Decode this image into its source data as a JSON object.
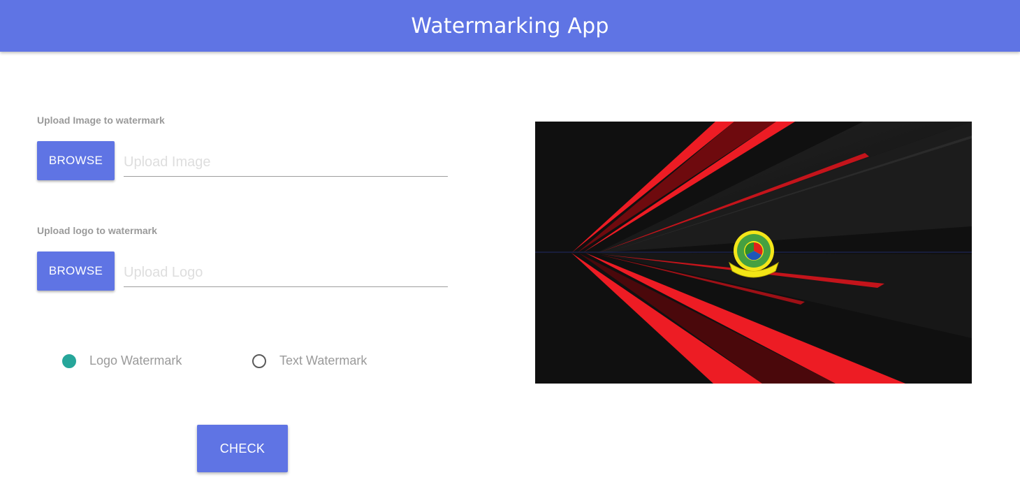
{
  "header": {
    "title": "Watermarking App"
  },
  "image_upload": {
    "label": "Upload Image to watermark",
    "browse_label": "BROWSE",
    "placeholder": "Upload Image",
    "value": ""
  },
  "logo_upload": {
    "label": "Upload logo to watermark",
    "browse_label": "BROWSE",
    "placeholder": "Upload Logo",
    "value": ""
  },
  "watermark_type": {
    "options": [
      {
        "label": "Logo Watermark",
        "checked": true
      },
      {
        "label": "Text Watermark",
        "checked": false
      }
    ]
  },
  "check_button": {
    "label": "CHECK"
  },
  "colors": {
    "primary": "#5f74e4",
    "radio_checked": "#26a69a",
    "muted_text": "#9a9a9a"
  },
  "preview": {
    "icon": "watermarked-image-preview",
    "watermark_icon": "circular-emblem-logo"
  }
}
